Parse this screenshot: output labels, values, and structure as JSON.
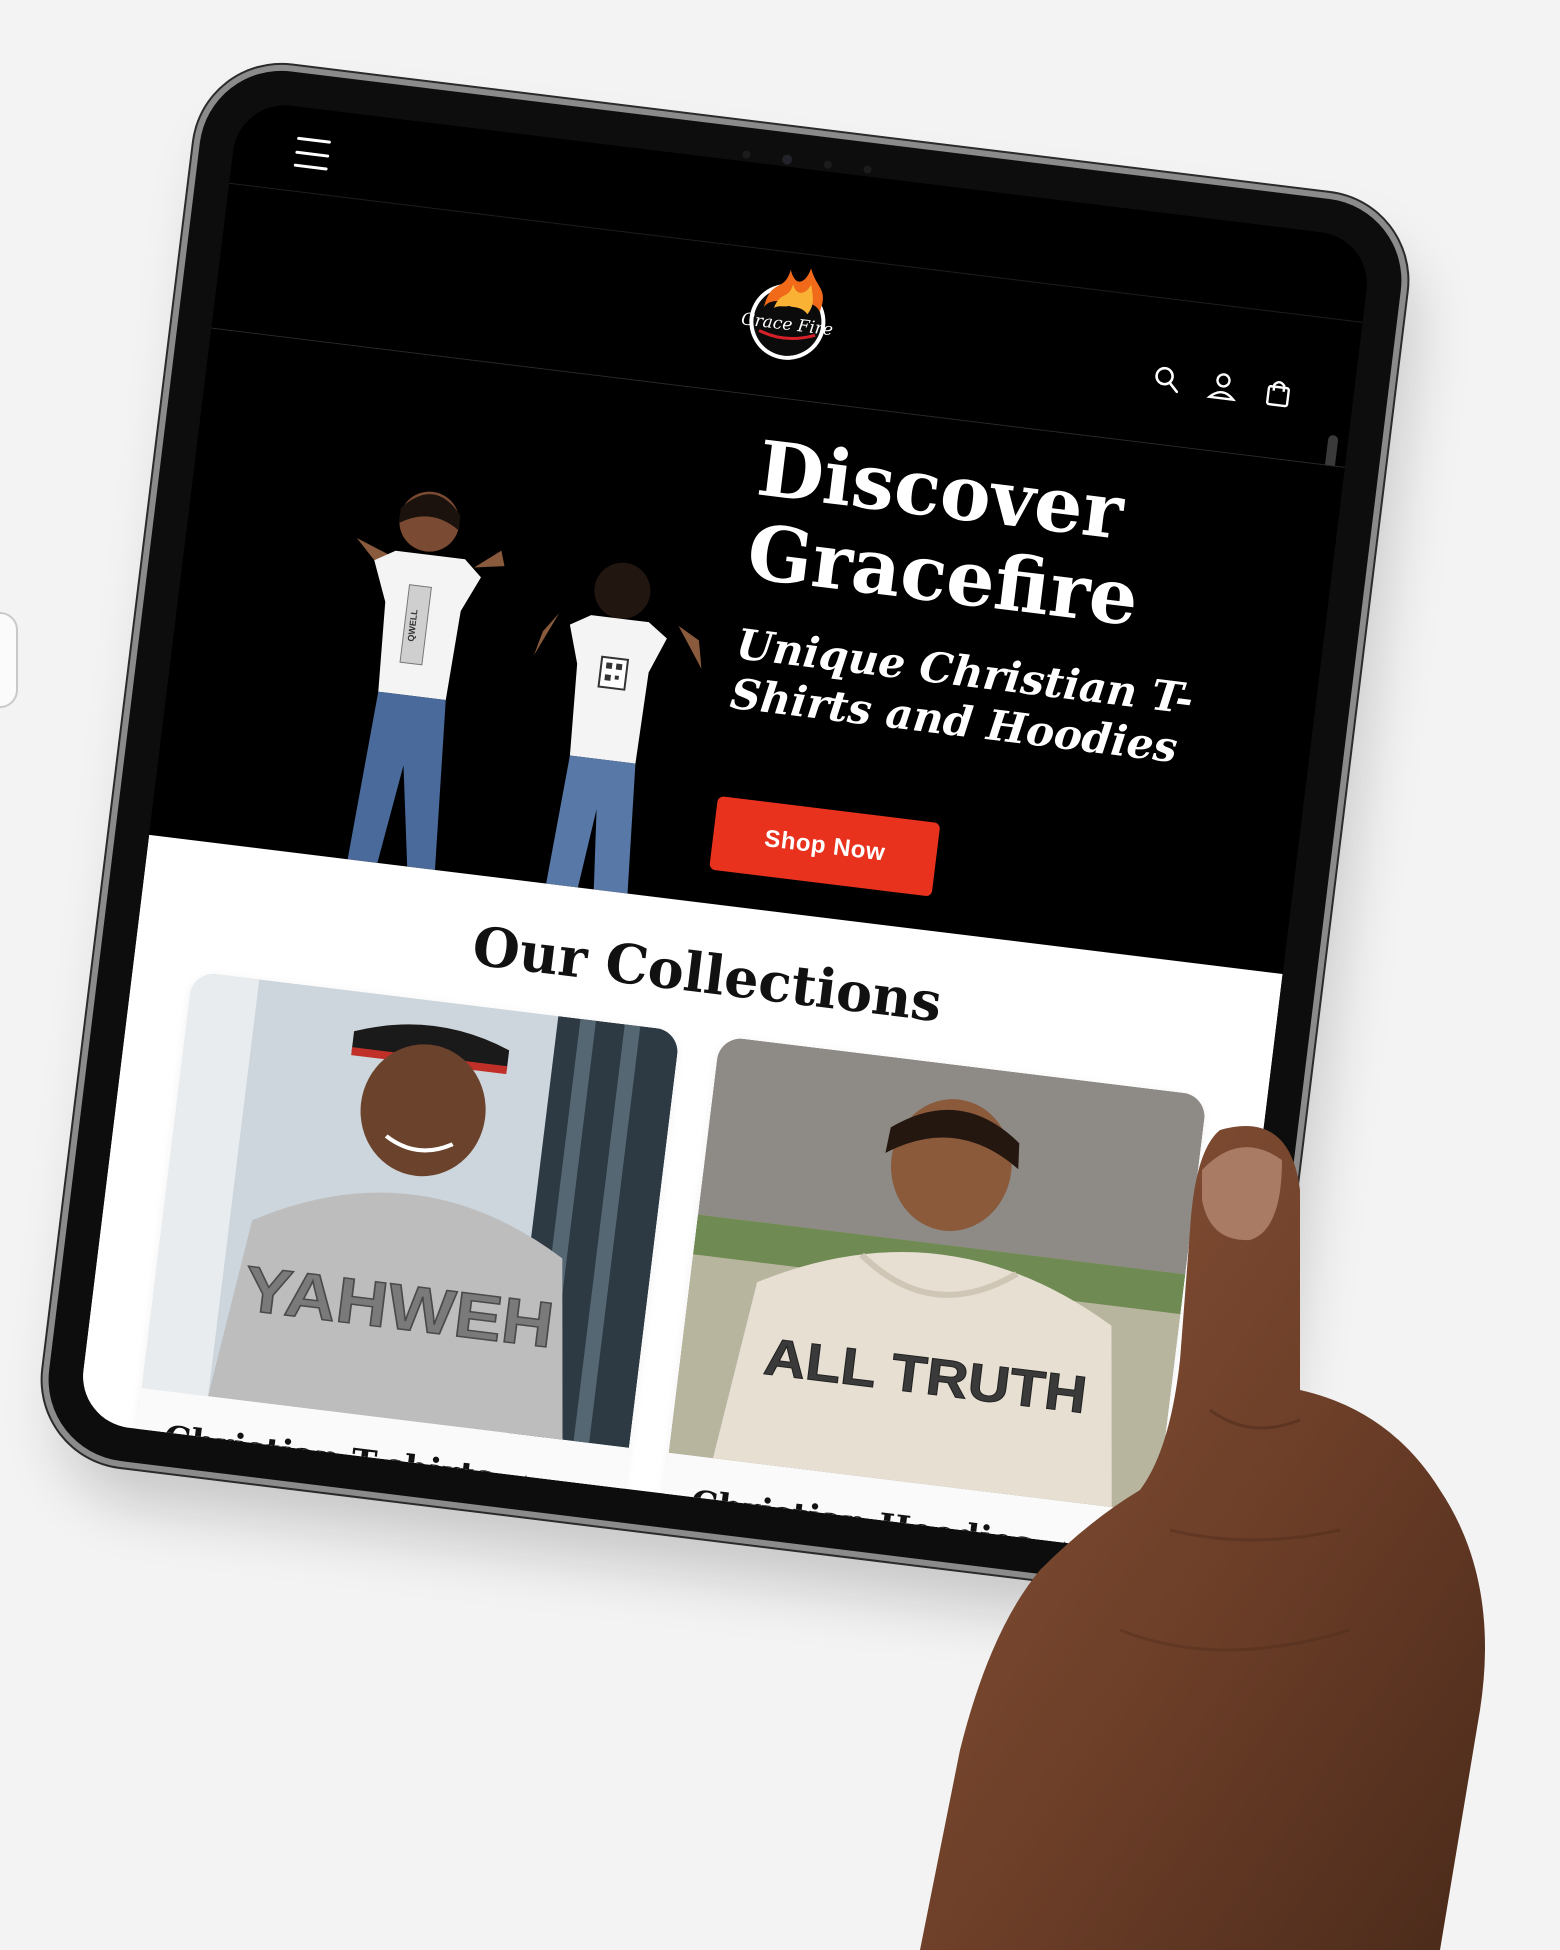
{
  "header": {
    "menu_icon": "hamburger-menu-icon",
    "logo_text": "Grace Fire",
    "icons": [
      "search-icon",
      "account-icon",
      "cart-bag-icon"
    ]
  },
  "hero": {
    "title": "Discover Gracefire",
    "subtitle": "Unique Christian T-Shirts and Hoodies",
    "cta_label": "Shop Now",
    "shirt_print_left": "QWELL",
    "accent_color": "#e8321e"
  },
  "collections": {
    "title": "Our Collections",
    "items": [
      {
        "label": "Christian T-shirts →",
        "shirt_text": "YAHWEH"
      },
      {
        "label": "Christian Hoodies →",
        "shirt_text": "ALL TRUTH"
      }
    ]
  }
}
